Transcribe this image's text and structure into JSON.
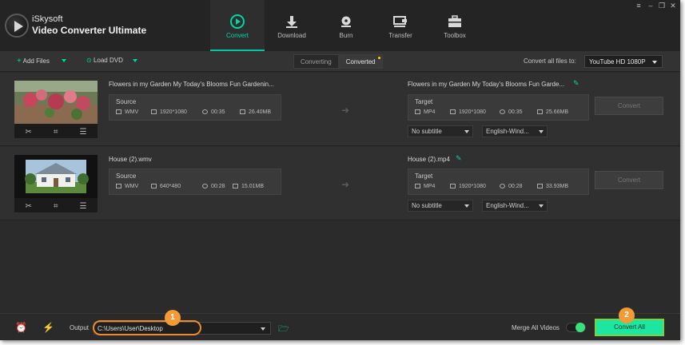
{
  "app": {
    "brand_line1": "iSkysoft",
    "brand_line2": "Video Converter Ultimate"
  },
  "nav": [
    {
      "label": "Convert",
      "icon": "convert-icon",
      "active": true
    },
    {
      "label": "Download",
      "icon": "download-icon"
    },
    {
      "label": "Burn",
      "icon": "burn-icon"
    },
    {
      "label": "Transfer",
      "icon": "transfer-icon"
    },
    {
      "label": "Toolbox",
      "icon": "toolbox-icon"
    }
  ],
  "window_controls": [
    "≡",
    "–",
    "❐",
    "✕"
  ],
  "toolbar": {
    "add_files": "Add Files",
    "load_dvd": "Load DVD",
    "tab_converting": "Converting",
    "tab_converted": "Converted",
    "convert_all_to_label": "Convert all files to:",
    "format": "YouTube HD 1080P"
  },
  "files": [
    {
      "source_name": "Flowers in my Garden  My Today's Blooms  Fun Gardenin...",
      "source_title": "Source",
      "source_format": "WMV",
      "source_res": "1920*1080",
      "source_duration": "00:35",
      "source_size": "26.40MB",
      "target_name": "Flowers in my Garden  My Today's Blooms  Fun Garde...",
      "target_title": "Target",
      "target_format": "MP4",
      "target_res": "1920*1080",
      "target_duration": "00:35",
      "target_size": "25.66MB",
      "subtitle": "No subtitle",
      "audio": "English-Wind...",
      "convert_label": "Convert"
    },
    {
      "source_name": "House (2).wmv",
      "source_title": "Source",
      "source_format": "WMV",
      "source_res": "640*480",
      "source_duration": "00:28",
      "source_size": "15.01MB",
      "target_name": "House (2).mp4",
      "target_title": "Target",
      "target_format": "MP4",
      "target_res": "1920*1080",
      "target_duration": "00:28",
      "target_size": "33.93MB",
      "subtitle": "No subtitle",
      "audio": "English-Wind...",
      "convert_label": "Convert"
    }
  ],
  "footer": {
    "output_label": "Output",
    "output_path": "C:\\Users\\User\\Desktop",
    "merge_label": "Merge All Videos",
    "merge_on": true,
    "convert_all": "Convert All",
    "badge1": "1",
    "badge2": "2"
  },
  "colors": {
    "accent": "#00d6a6",
    "callout": "#f29a36",
    "convert_all_bg": "#1de6a0"
  }
}
